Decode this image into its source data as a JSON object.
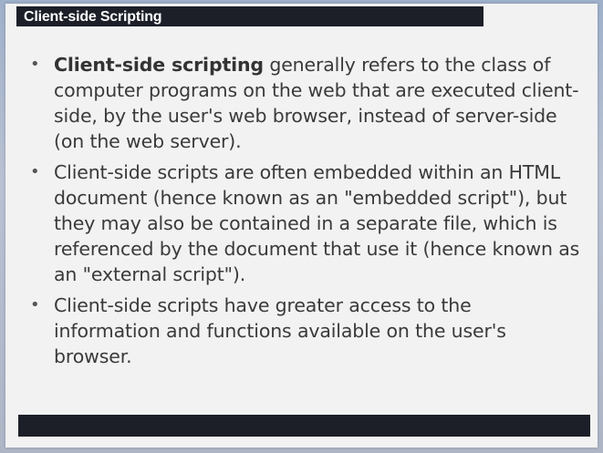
{
  "slide": {
    "title": "Client-side Scripting",
    "bullets": [
      {
        "bold": "Client-side scripting",
        "text": " generally refers to the class of computer programs on the web that are executed client-side, by the user's web browser, instead of server-side  (on the web server)."
      },
      {
        "bold": "",
        "text": "Client-side scripts are often embedded within an HTML document (hence known as an \"embedded script\"), but they may also be contained in a separate file, which is referenced by the document that use it (hence known as an \"external script\")."
      },
      {
        "bold": "",
        "text": "Client-side scripts have greater access to the information and functions available on the user's browser."
      }
    ],
    "bullet_symbol": "•",
    "colors": {
      "title_bar": "#1c1f28",
      "title_text": "#ffffff",
      "body_text": "#3a3a3a",
      "slide_background": "#f2f2f2"
    }
  }
}
